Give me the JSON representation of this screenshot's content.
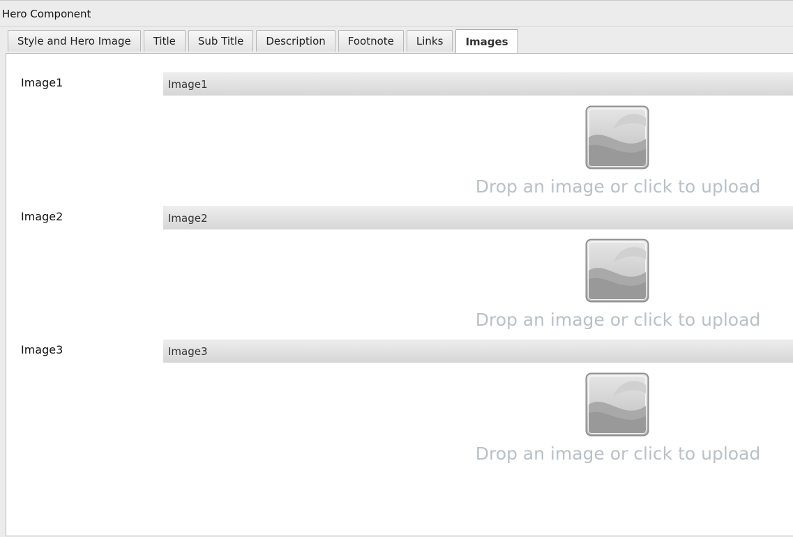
{
  "dialog": {
    "title": "Hero Component"
  },
  "tabs": [
    {
      "label": "Style and Hero Image",
      "active": false
    },
    {
      "label": "Title",
      "active": false
    },
    {
      "label": "Sub Title",
      "active": false
    },
    {
      "label": "Description",
      "active": false
    },
    {
      "label": "Footnote",
      "active": false
    },
    {
      "label": "Links",
      "active": false
    },
    {
      "label": "Images",
      "active": true
    }
  ],
  "fields": [
    {
      "label": "Image1",
      "header": "Image1",
      "drop_text": "Drop an image or click to upload",
      "icon": "image-placeholder-icon"
    },
    {
      "label": "Image2",
      "header": "Image2",
      "drop_text": "Drop an image or click to upload",
      "icon": "image-placeholder-icon"
    },
    {
      "label": "Image3",
      "header": "Image3",
      "drop_text": "Drop an image or click to upload",
      "icon": "image-placeholder-icon"
    }
  ],
  "colors": {
    "drop_text": "#b9c0c7",
    "panel_background": "#ffffff",
    "dialog_background": "#ececec"
  }
}
